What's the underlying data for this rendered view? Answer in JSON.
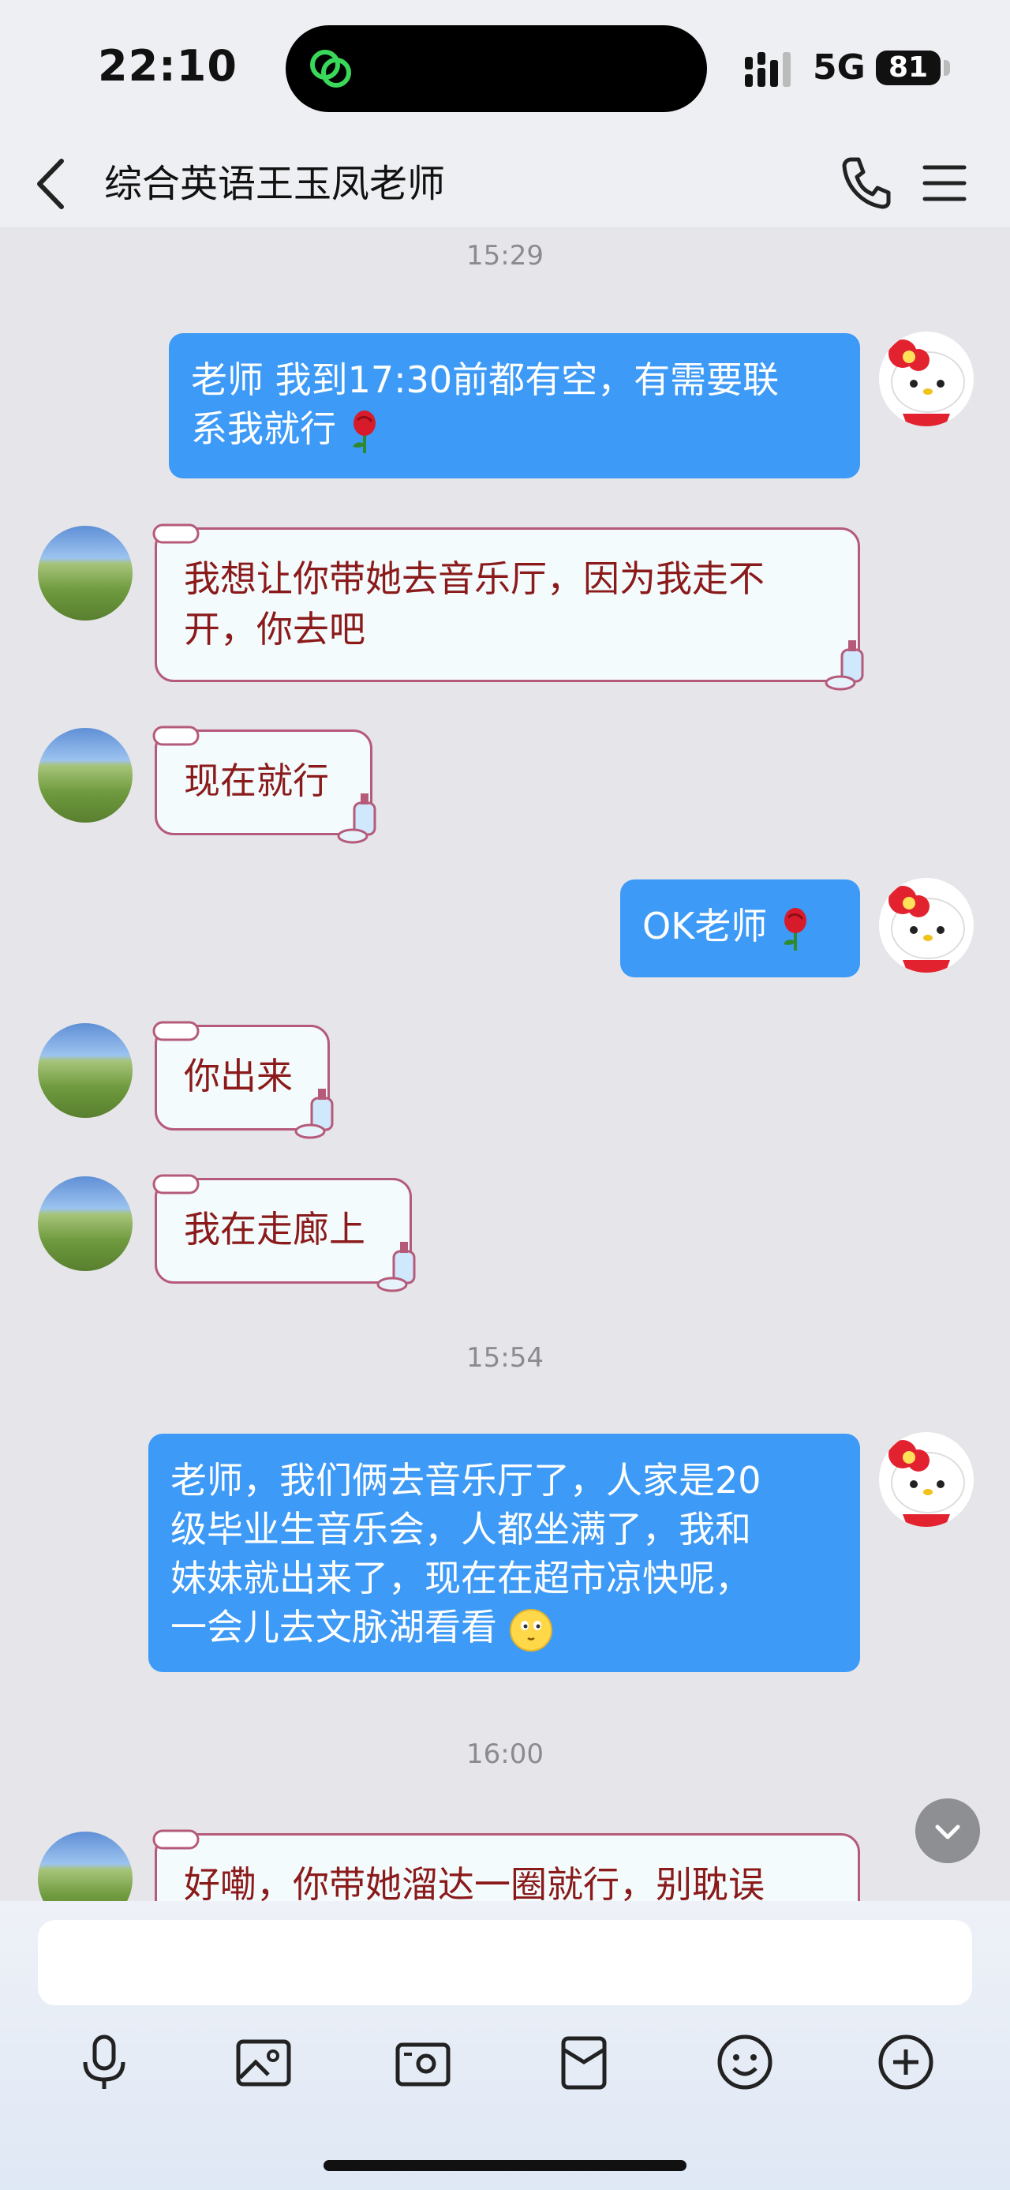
{
  "status_bar": {
    "time": "22:10",
    "network": "5G",
    "battery": "81"
  },
  "header": {
    "title": "综合英语王玉凤老师",
    "back_icon": "chevron-left-icon",
    "call_icon": "phone-icon",
    "menu_icon": "hamburger-menu-icon"
  },
  "messages": [
    {
      "type": "timestamp",
      "text": "15:29"
    },
    {
      "type": "outgoing",
      "lines": [
        "老师 我到17:30前都有空，有需要联",
        "系我就行"
      ],
      "emoji": "rose"
    },
    {
      "type": "incoming",
      "lines": [
        "我想让你带她去音乐厅，因为我走不",
        "开，你去吧"
      ]
    },
    {
      "type": "incoming",
      "lines": [
        "现在就行"
      ]
    },
    {
      "type": "outgoing",
      "lines": [
        "OK老师"
      ],
      "emoji": "rose"
    },
    {
      "type": "incoming",
      "lines": [
        "你出来"
      ]
    },
    {
      "type": "incoming",
      "lines": [
        "我在走廊上"
      ]
    },
    {
      "type": "timestamp",
      "text": "15:54"
    },
    {
      "type": "outgoing",
      "lines": [
        "老师，我们俩去音乐厅了，人家是20",
        "级毕业生音乐会，人都坐满了，我和",
        "妹妹就出来了，现在在超市凉快呢，",
        "一会儿去文脉湖看看"
      ],
      "emoji": "blush"
    },
    {
      "type": "timestamp",
      "text": "16:00"
    },
    {
      "type": "incoming",
      "lines": [
        "好嘞，你带她溜达一圈就行，别耽误"
      ]
    }
  ],
  "composer": {
    "input_value": "",
    "tools": [
      "microphone-icon",
      "photo-icon",
      "camera-icon",
      "red-packet-icon",
      "emoji-icon",
      "plus-icon"
    ]
  },
  "colors": {
    "outgoing_bubble": "#3d9af6",
    "incoming_text": "#8b1a1a",
    "incoming_border": "#b65a7a",
    "chat_bg": "#e6e6ea"
  }
}
